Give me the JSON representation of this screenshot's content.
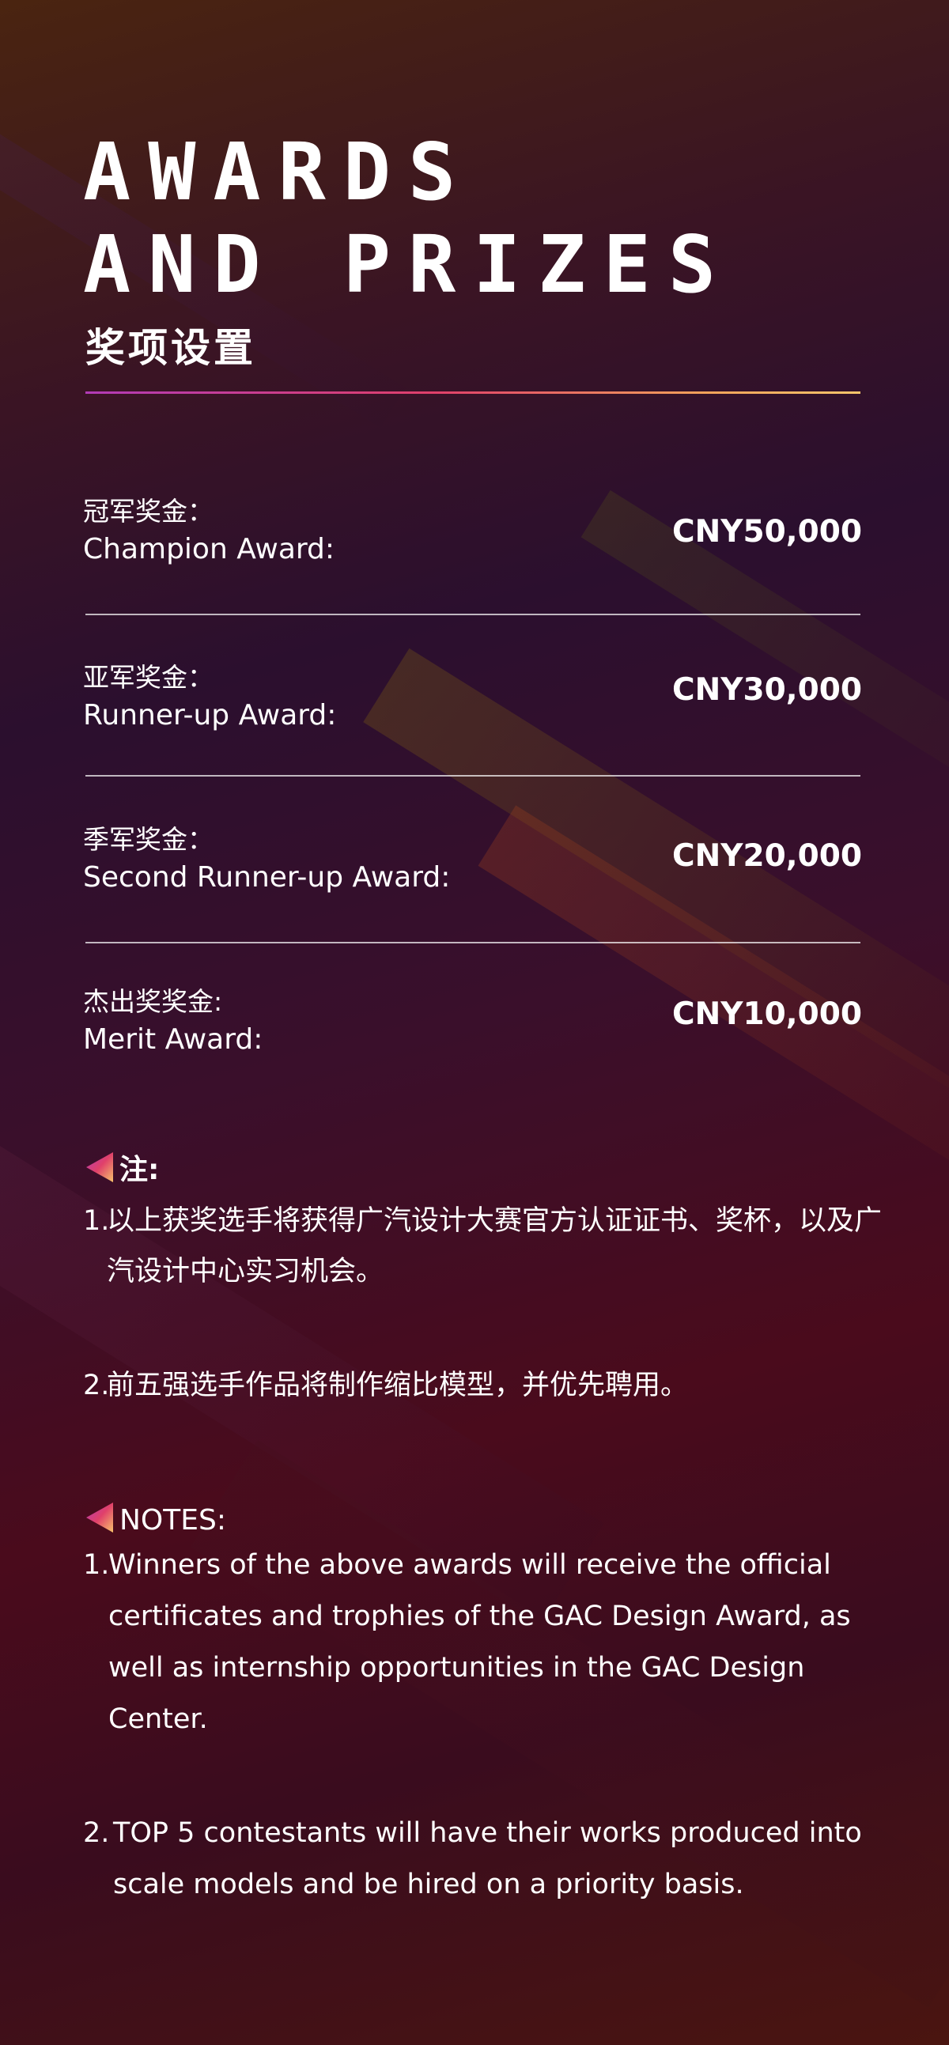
{
  "header": {
    "title_line1": "AWARDS",
    "title_line2": "AND PRIZES",
    "subtitle": "奖项设置"
  },
  "awards": [
    {
      "cn": "冠军奖金：",
      "en": "Champion Award:",
      "amount": "CNY50,000"
    },
    {
      "cn": "亚军奖金：",
      "en": "Runner-up Award:",
      "amount": "CNY30,000"
    },
    {
      "cn": "季军奖金：",
      "en": "Second Runner-up Award:",
      "amount": "CNY20,000"
    },
    {
      "cn": "杰出奖奖金:",
      "en": "Merit Award:",
      "amount": "CNY10,000"
    }
  ],
  "notes_cn": {
    "heading": "注:",
    "items": [
      {
        "num": "1.",
        "text": "以上获奖选手将获得广汽设计大赛官方认证证书、奖杯，以及广汽设计中心实习机会。"
      },
      {
        "num": "2.",
        "text": "前五强选手作品将制作缩比模型，并优先聘用。"
      }
    ]
  },
  "notes_en": {
    "heading": "NOTES:",
    "items": [
      {
        "num": "1.",
        "text": "Winners of the above awards will receive the official certificates and trophies of the GAC Design Award, as well as internship opportunities in the GAC Design Center."
      },
      {
        "num": "2.",
        "text": "TOP 5 contestants will have their works produced into scale models and be hired on a priority basis."
      }
    ]
  },
  "colors": {
    "accent_gradient_start": "#b23cb6",
    "accent_gradient_mid": "#e0406a",
    "accent_gradient_end": "#f7c56b",
    "text": "#ffffff"
  },
  "icons": {
    "note_marker": "gradient-triangle-icon"
  }
}
